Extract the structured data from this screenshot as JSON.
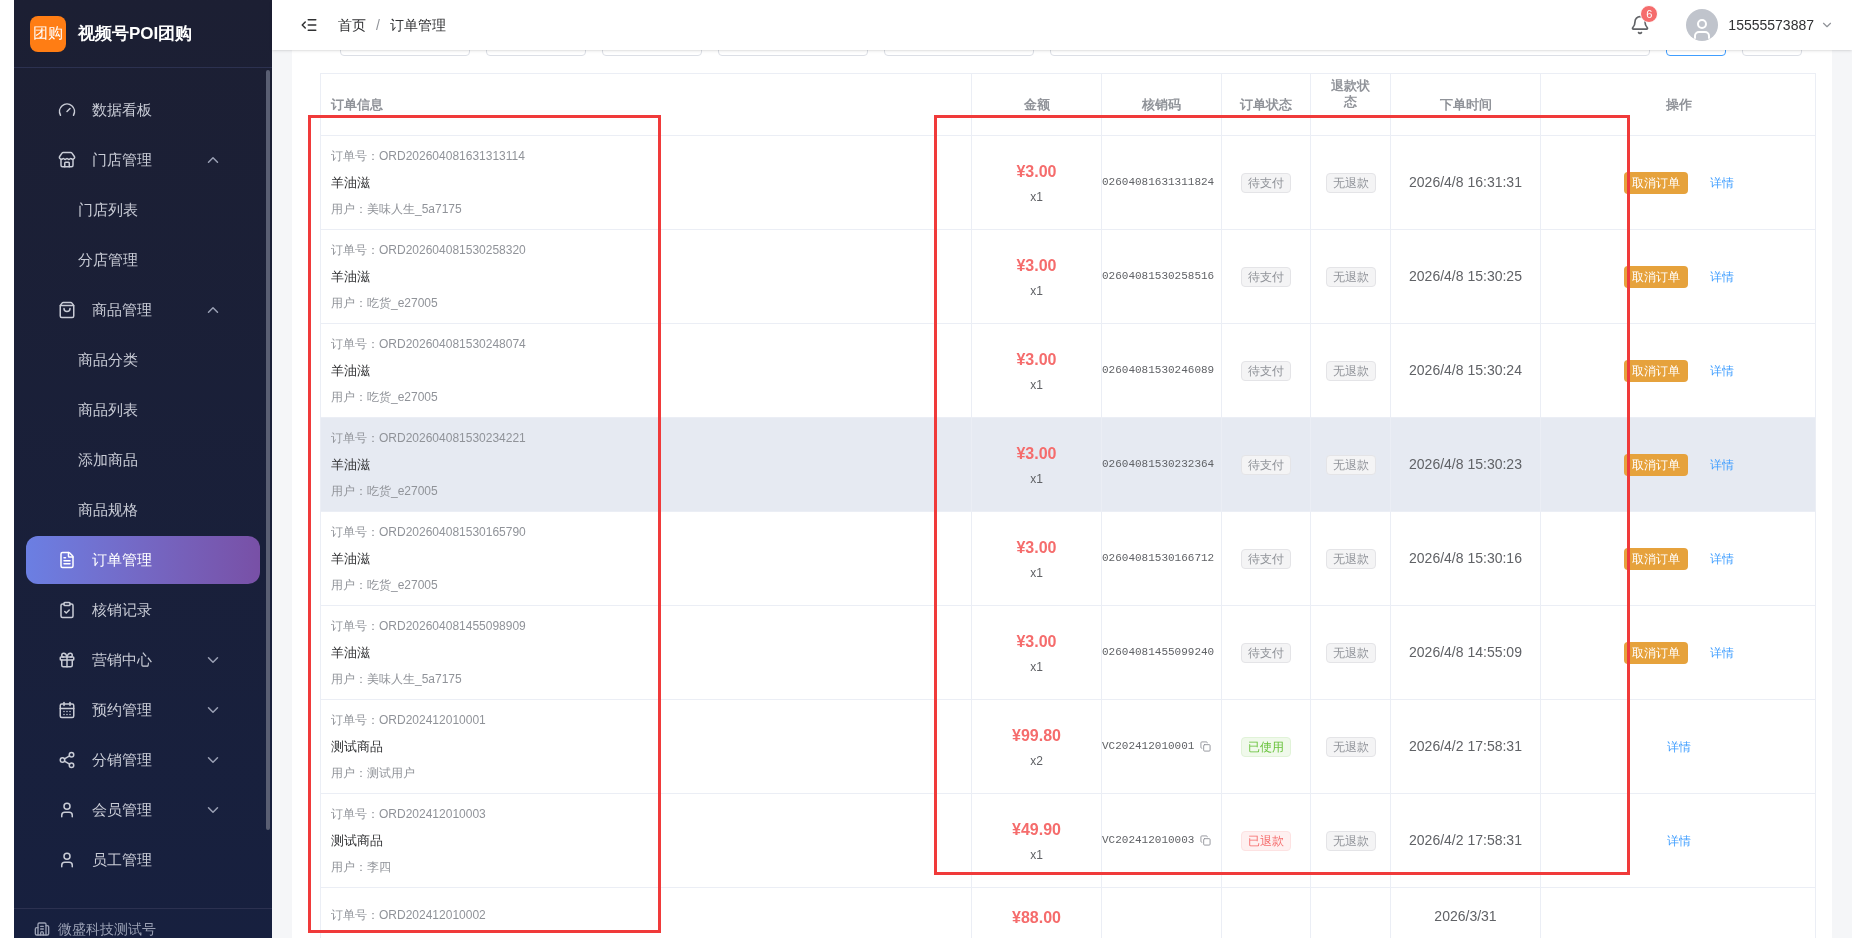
{
  "brand": {
    "logo_text": "团购",
    "name": "视频号POI团购"
  },
  "sidebar": {
    "items": [
      {
        "label": "数据看板",
        "selected": false
      },
      {
        "label": "门店管理",
        "selected": false,
        "expanded": true,
        "children": [
          {
            "label": "门店列表",
            "selected": false
          },
          {
            "label": "分店管理",
            "selected": false
          }
        ]
      },
      {
        "label": "商品管理",
        "selected": false,
        "expanded": true,
        "children": [
          {
            "label": "商品分类",
            "selected": false
          },
          {
            "label": "商品列表",
            "selected": false
          },
          {
            "label": "添加商品",
            "selected": false
          },
          {
            "label": "商品规格",
            "selected": false
          }
        ]
      },
      {
        "label": "订单管理",
        "selected": true
      },
      {
        "label": "核销记录",
        "selected": false
      },
      {
        "label": "营销中心",
        "selected": false,
        "expanded": false
      },
      {
        "label": "预约管理",
        "selected": false,
        "expanded": false
      },
      {
        "label": "分销管理",
        "selected": false,
        "expanded": false
      },
      {
        "label": "会员管理",
        "selected": false,
        "expanded": false
      },
      {
        "label": "员工管理",
        "selected": false
      }
    ],
    "footer": "微盛科技测试号"
  },
  "header": {
    "breadcrumb": [
      "首页",
      "订单管理"
    ],
    "separator": "/",
    "notifications": "6",
    "user": "15555573887"
  },
  "table": {
    "columns": [
      "订单信息",
      "金额",
      "核销码",
      "订单状态",
      "退款状态",
      "下单时间",
      "操作"
    ],
    "rows": [
      {
        "order_no": "订单号：ORD202604081631313114",
        "product": "羊油滋",
        "user": "用户：美味人生_5a7175",
        "amount": "¥3.00",
        "qty": "x1",
        "code": "02604081631311824",
        "copyable": false,
        "order_status": {
          "label": "待支付",
          "kind": "pending"
        },
        "refund_status": "无退款",
        "time": "2026/4/8 16:31:31",
        "cancel": "取消订单",
        "detail": "详情",
        "highlighted": false
      },
      {
        "order_no": "订单号：ORD202604081530258320",
        "product": "羊油滋",
        "user": "用户：吃货_e27005",
        "amount": "¥3.00",
        "qty": "x1",
        "code": "02604081530258516",
        "copyable": false,
        "order_status": {
          "label": "待支付",
          "kind": "pending"
        },
        "refund_status": "无退款",
        "time": "2026/4/8 15:30:25",
        "cancel": "取消订单",
        "detail": "详情",
        "highlighted": false
      },
      {
        "order_no": "订单号：ORD202604081530248074",
        "product": "羊油滋",
        "user": "用户：吃货_e27005",
        "amount": "¥3.00",
        "qty": "x1",
        "code": "02604081530246089",
        "copyable": false,
        "order_status": {
          "label": "待支付",
          "kind": "pending"
        },
        "refund_status": "无退款",
        "time": "2026/4/8 15:30:24",
        "cancel": "取消订单",
        "detail": "详情",
        "highlighted": false
      },
      {
        "order_no": "订单号：ORD202604081530234221",
        "product": "羊油滋",
        "user": "用户：吃货_e27005",
        "amount": "¥3.00",
        "qty": "x1",
        "code": "02604081530232364",
        "copyable": false,
        "order_status": {
          "label": "待支付",
          "kind": "pending"
        },
        "refund_status": "无退款",
        "time": "2026/4/8 15:30:23",
        "cancel": "取消订单",
        "detail": "详情",
        "highlighted": true
      },
      {
        "order_no": "订单号：ORD202604081530165790",
        "product": "羊油滋",
        "user": "用户：吃货_e27005",
        "amount": "¥3.00",
        "qty": "x1",
        "code": "02604081530166712",
        "copyable": false,
        "order_status": {
          "label": "待支付",
          "kind": "pending"
        },
        "refund_status": "无退款",
        "time": "2026/4/8 15:30:16",
        "cancel": "取消订单",
        "detail": "详情",
        "highlighted": false
      },
      {
        "order_no": "订单号：ORD202604081455098909",
        "product": "羊油滋",
        "user": "用户：美味人生_5a7175",
        "amount": "¥3.00",
        "qty": "x1",
        "code": "02604081455099240",
        "copyable": false,
        "order_status": {
          "label": "待支付",
          "kind": "pending"
        },
        "refund_status": "无退款",
        "time": "2026/4/8 14:55:09",
        "cancel": "取消订单",
        "detail": "详情",
        "highlighted": false
      },
      {
        "order_no": "订单号：ORD202412010001",
        "product": "测试商品",
        "user": "用户：测试用户",
        "amount": "¥99.80",
        "qty": "x2",
        "code": "VC202412010001",
        "copyable": true,
        "order_status": {
          "label": "已使用",
          "kind": "used"
        },
        "refund_status": "无退款",
        "time": "2026/4/2 17:58:31",
        "detail": "详情",
        "highlighted": false
      },
      {
        "order_no": "订单号：ORD202412010003",
        "product": "测试商品",
        "user": "用户：李四",
        "amount": "¥49.90",
        "qty": "x1",
        "code": "VC202412010003",
        "copyable": true,
        "order_status": {
          "label": "已退款",
          "kind": "refunded"
        },
        "refund_status": "无退款",
        "time": "2026/4/2 17:58:31",
        "detail": "详情",
        "highlighted": false
      },
      {
        "order_no": "订单号：ORD202412010002",
        "amount": "¥88.00",
        "time": "2026/3/31",
        "highlighted": false
      }
    ]
  }
}
